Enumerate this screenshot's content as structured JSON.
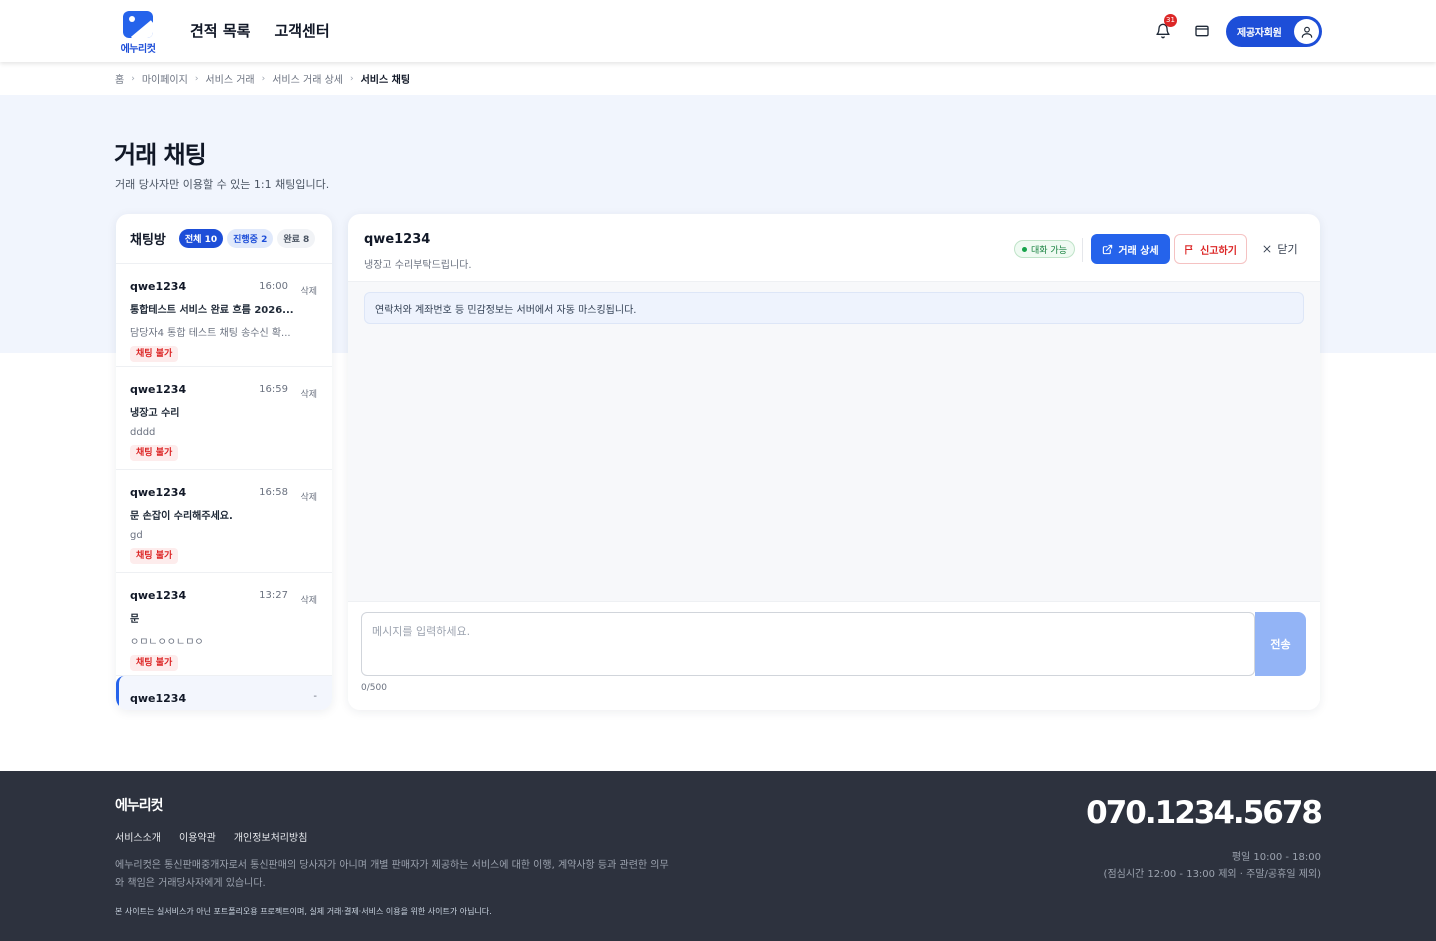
{
  "header": {
    "logo_text": "에누리컷",
    "nav": [
      "견적 목록",
      "고객센터"
    ],
    "notification_count": "31",
    "user_label": "제공자회원"
  },
  "breadcrumb": [
    "홈",
    "마이페이지",
    "서비스 거래",
    "서비스 거래 상세",
    "서비스 채팅"
  ],
  "page": {
    "title": "거래 채팅",
    "subtitle": "거래 당사자만 이용할 수 있는 1:1 채팅입니다."
  },
  "rooms": {
    "title": "채팅방",
    "filters": {
      "all": "전체 10",
      "ongoing": "진행중 2",
      "done": "완료 8"
    },
    "delete_label": "삭제",
    "items": [
      {
        "name": "qwe1234",
        "time": "16:00",
        "subject": "통합테스트 서비스 완료 흐름 2026...",
        "preview": "담당자4 통합 테스트 채팅 송수신 확...",
        "status": "채팅 불가"
      },
      {
        "name": "qwe1234",
        "time": "16:59",
        "subject": "냉장고 수리",
        "preview": "dddd",
        "status": "채팅 불가"
      },
      {
        "name": "qwe1234",
        "time": "16:58",
        "subject": "문 손잡이 수리해주세요.",
        "preview": "gd",
        "status": "채팅 불가"
      },
      {
        "name": "qwe1234",
        "time": "13:27",
        "subject": "문",
        "preview": "ㅇㅁㄴㅇㅇㄴㅁㅇ",
        "status": "채팅 불가"
      },
      {
        "name": "qwe1234",
        "time": "-"
      }
    ]
  },
  "chat": {
    "partner": "qwe1234",
    "subject": "냉장고 수리부탁드립니다.",
    "availability": "대화 가능",
    "detail_button": "거래 상세",
    "report_button": "신고하기",
    "close_button": "닫기",
    "notice": "연락처와 계좌번호 등 민감정보는 서버에서 자동 마스킹됩니다.",
    "input_placeholder": "메시지를 입력하세요.",
    "send_button": "전송",
    "char_count": "0/500"
  },
  "footer": {
    "logo": "에누리컷",
    "links": [
      "서비스소개",
      "이용약관",
      "개인정보처리방침"
    ],
    "description": "에누리컷은 통신판매중개자로서 통신판매의 당사자가 아니며 개별 판매자가 제공하는 서비스에 대한 이행, 계약사항 등과 관련한 의무와 책임은 거래당사자에게 있습니다.",
    "note": "본 사이트는 실서비스가 아닌 포트폴리오용 프로젝트이며, 실제 거래·결제·서비스 이용을 위한 사이트가 아닙니다.",
    "phone": "070.1234.5678",
    "hours": "평일 10:00 - 18:00",
    "break": "(점심시간 12:00 - 13:00 제외 · 주말/공휴일 제외)"
  },
  "colors": {
    "primary": "#2563eb",
    "danger": "#dc2626",
    "success": "#16a34a",
    "footer_bg": "#2d323e",
    "hero_bg": "#f1f5fd"
  }
}
